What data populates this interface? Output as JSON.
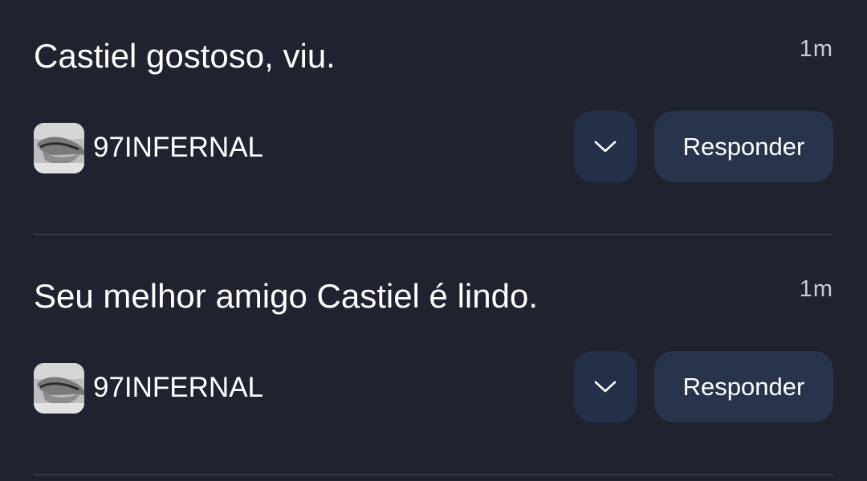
{
  "notifications": [
    {
      "message": "Castiel gostoso, viu.",
      "time": "1m",
      "author": "97INFERNAL",
      "avatar_icon": "avatar-lips-photo",
      "expand_icon": "chevron-down-icon",
      "reply_label": "Responder"
    },
    {
      "message": "Seu melhor amigo Castiel é lindo.",
      "time": "1m",
      "author": "97INFERNAL",
      "avatar_icon": "avatar-lips-photo",
      "expand_icon": "chevron-down-icon",
      "reply_label": "Responder"
    }
  ]
}
